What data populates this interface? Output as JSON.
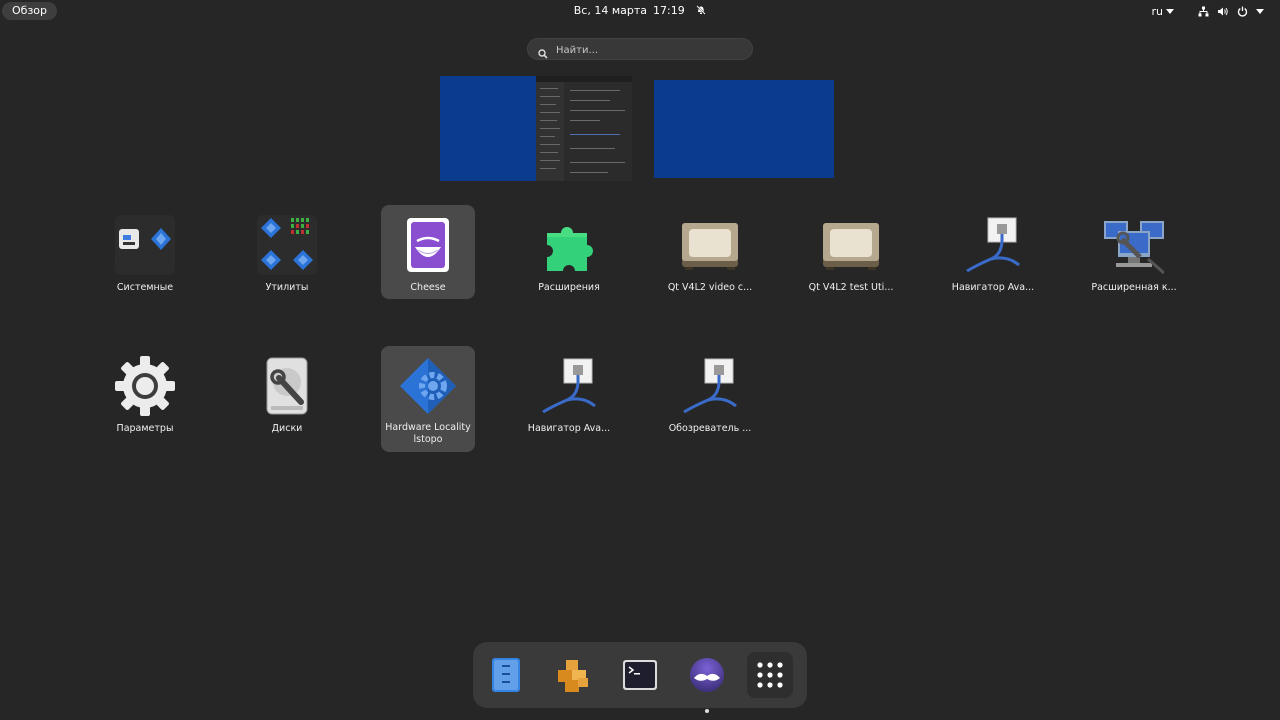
{
  "topbar": {
    "activities_label": "Обзор",
    "date": "Вс, 14 марта",
    "time": "17:19",
    "language": "ru",
    "icons": [
      "notifications-off-icon",
      "network-icon",
      "volume-icon",
      "power-icon"
    ]
  },
  "search": {
    "placeholder": "Найти..."
  },
  "workspaces": [
    {
      "has_window": true
    },
    {
      "has_window": false
    }
  ],
  "apps": [
    {
      "label": "Системные",
      "icon": "folder-system-icon",
      "selected": false
    },
    {
      "label": "Утилиты",
      "icon": "folder-utilities-icon",
      "selected": false
    },
    {
      "label": "Cheese",
      "icon": "cheese-icon",
      "selected": true
    },
    {
      "label": "Расширения",
      "icon": "extensions-puzzle-icon",
      "selected": false
    },
    {
      "label": "Qt V4L2 video c...",
      "icon": "qt-v4l2-video-icon",
      "selected": false
    },
    {
      "label": "Qt V4L2 test Uti...",
      "icon": "qt-v4l2-test-icon",
      "selected": false
    },
    {
      "label": "Навигатор Ava...",
      "icon": "avahi-navigator-icon",
      "selected": false
    },
    {
      "label": "Расширенная к...",
      "icon": "network-config-icon",
      "selected": false
    },
    {
      "label": "Параметры",
      "icon": "settings-gear-icon",
      "selected": false
    },
    {
      "label": "Диски",
      "icon": "disks-icon",
      "selected": false
    },
    {
      "label": "Hardware Locality lstopo",
      "icon": "hwloc-icon",
      "selected": true
    },
    {
      "label": "Навигатор Ava...",
      "icon": "avahi-navigator-icon",
      "selected": false
    },
    {
      "label": "Обозреватель ...",
      "icon": "avahi-browser-icon",
      "selected": false
    }
  ],
  "dash": {
    "items": [
      {
        "name": "files-icon",
        "running": false
      },
      {
        "name": "software-packages-icon",
        "running": false
      },
      {
        "name": "terminal-icon",
        "running": false
      },
      {
        "name": "tor-browser-icon",
        "running": true
      }
    ],
    "show_apps": "show-apps-grid-icon"
  },
  "colors": {
    "background": "#262626",
    "workspace": "#0a3b8c",
    "selected_tile": "#4a4a4a"
  }
}
